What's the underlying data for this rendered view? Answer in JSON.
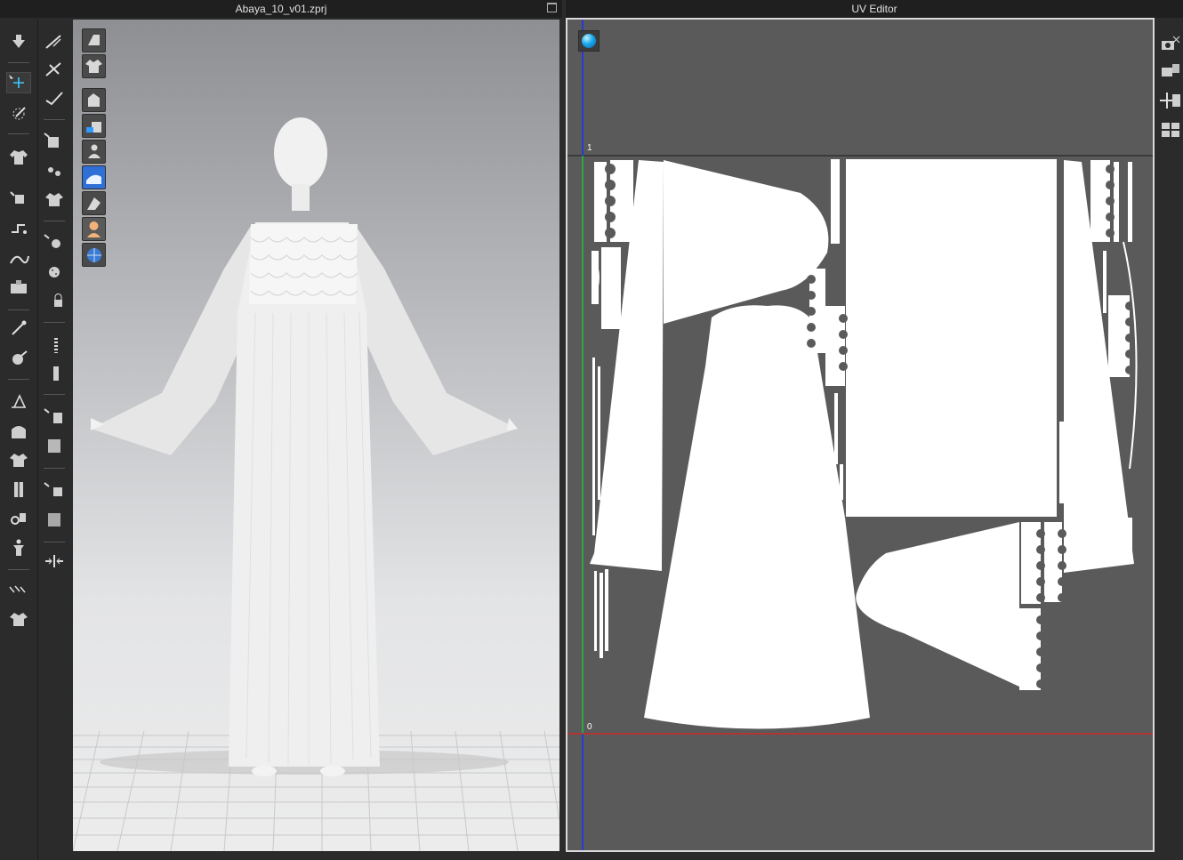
{
  "viewport": {
    "title": "Abaya_10_v01.zprj"
  },
  "uv_editor": {
    "title": "UV Editor",
    "axis_top": "1",
    "axis_origin": "0"
  },
  "left_toolbar": {
    "col1": [
      "select-move-tool",
      "transform-pattern-tool",
      "edit-pattern-tool",
      "simulation-tool",
      "pin-tool",
      "garment-fit-tool",
      "strain-map-tool",
      "fabric-tool",
      "texture-tool",
      "avatar-tool",
      "arrangement-tool",
      "fold-tool",
      "seam-tool",
      "tack-tool",
      "clone-tool",
      "mirror-tool",
      "shirring-tool",
      "avatar-measure-tool",
      "fitting-tool",
      "undo-tool"
    ],
    "col2": [
      "trace-tool",
      "segment-tool",
      "internal-line-tool",
      "texture-edit-tool",
      "button-tool",
      "buttonhole-tool",
      "select-button-tool",
      "zipper-tool",
      "zipper-puller-tool",
      "puckering-tool",
      "graphic-tool",
      "transform-graphic-tool",
      "trim-tool",
      "transform-trim-tool",
      "flatten-tool"
    ]
  },
  "viewport_controls": [
    "show-3d-pattern-icon",
    "show-garment-icon",
    "show-avatar-garment-icon",
    "show-texture-icon",
    "show-avatar-icon",
    "avatar-skin-toggle-icon",
    "wireframe-icon",
    "world-grid-icon"
  ],
  "right_strip": [
    "uv-snapshot-icon",
    "uv-export-icon",
    "uv-transform-icon",
    "uv-arrange-icon"
  ],
  "colors": {
    "uv_bg": "#5a5a5a",
    "pattern": "#ffffff",
    "axis_x": "#e02020",
    "axis_y": "#1a30ff",
    "axis_v": "#22cc22"
  }
}
